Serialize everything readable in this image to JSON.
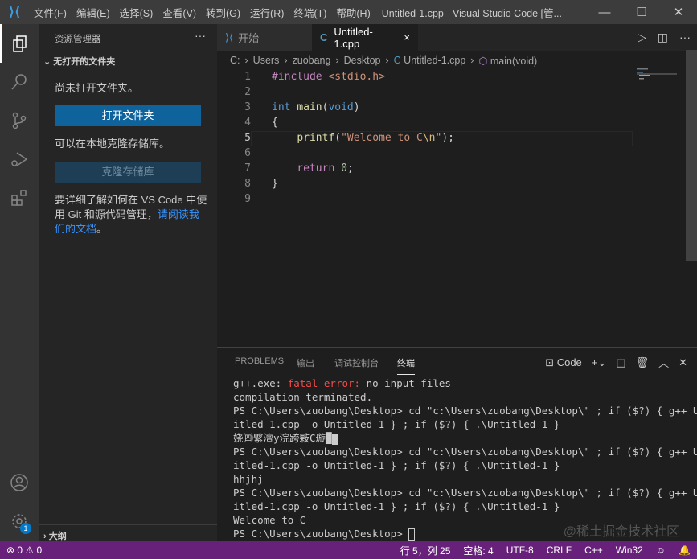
{
  "titlebar": {
    "menus": [
      "文件(F)",
      "编辑(E)",
      "选择(S)",
      "查看(V)",
      "转到(G)",
      "运行(R)",
      "终端(T)",
      "帮助(H)"
    ],
    "title": "Untitled-1.cpp - Visual Studio Code [管..."
  },
  "sidebar": {
    "title": "资源管理器",
    "section": "无打开的文件夹",
    "no_folder": "尚未打开文件夹。",
    "open_folder_btn": "打开文件夹",
    "clone_text": "可以在本地克隆存储库。",
    "clone_btn": "克隆存储库",
    "learn_text": "要详细了解如何在 VS Code 中使用 Git 和源代码管理，",
    "learn_link": "请阅读我们的文档",
    "learn_end": "。",
    "outline": "大纲"
  },
  "tabs": [
    {
      "label": "开始"
    },
    {
      "label": "Untitled-1.cpp",
      "close": "×"
    }
  ],
  "breadcrumb": [
    "C:",
    "Users",
    "zuobang",
    "Desktop",
    "Untitled-1.cpp",
    "main(void)"
  ],
  "editor": {
    "line_numbers": [
      "1",
      "2",
      "3",
      "4",
      "5",
      "6",
      "7",
      "8",
      "9"
    ],
    "current_line": 5
  },
  "panel": {
    "tabs": [
      "PROBLEMS",
      "输出",
      "调试控制台",
      "终端"
    ],
    "active_tab": "终端",
    "terminal_name": "Code",
    "lines": [
      "g++.exe: ",
      "fatal error:",
      " no input files",
      "compilation terminated.",
      "PS C:\\Users\\zuobang\\Desktop> cd \"c:\\Users\\zuobang\\Desktop\\\" ; if ($?) { g++ Unt",
      "itled-1.cpp -o Untitled-1 } ; if ($?) { .\\Untitled-1 }",
      "娆㈣繋澶у浣跨敤C璇█",
      "hhjhj",
      "Welcome to C",
      "PS C:\\Users\\zuobang\\Desktop> "
    ],
    "watermark": "@稀土掘金技术社区"
  },
  "statusbar": {
    "errors": "0",
    "warnings": "0",
    "position": "行 5，列 25",
    "spaces": "空格: 4",
    "encoding": "UTF-8",
    "eol": "CRLF",
    "language": "C++",
    "platform": "Win32",
    "settings_badge": "1",
    "color": "#68217a"
  }
}
